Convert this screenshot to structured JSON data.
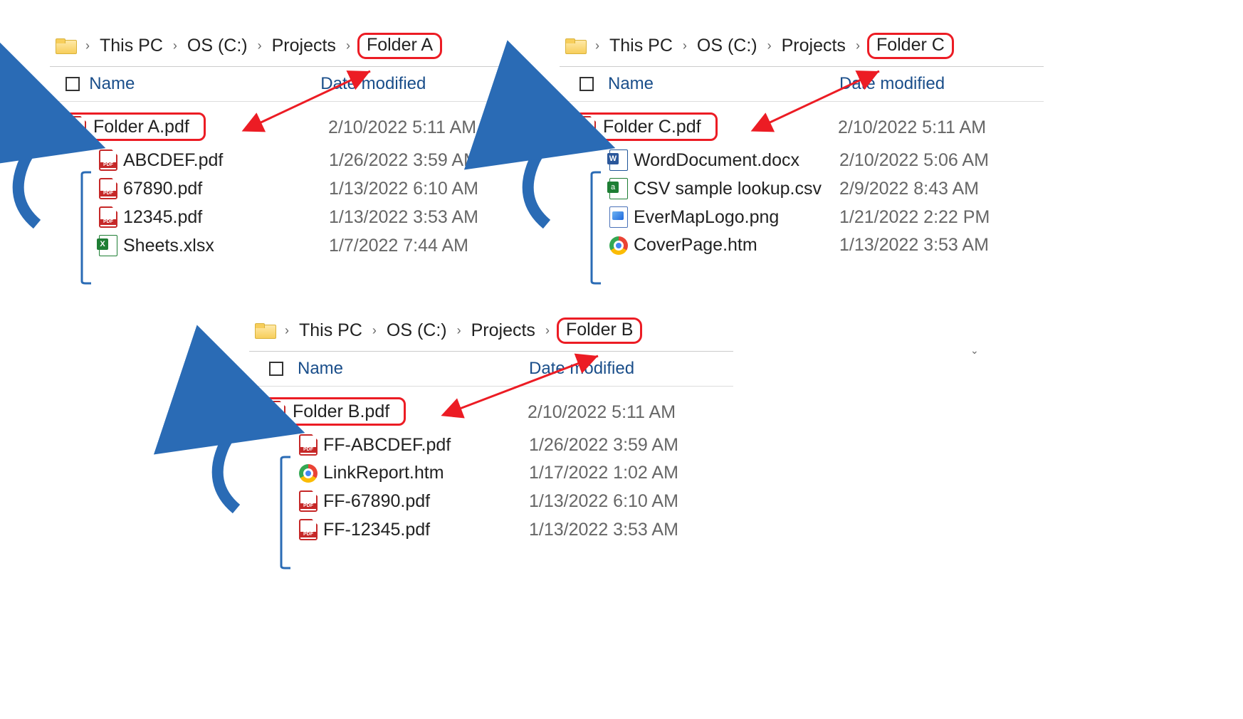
{
  "windows": [
    {
      "id": "a",
      "breadcrumb": [
        "This PC",
        "OS (C:)",
        "Projects",
        "Folder A"
      ],
      "headers": {
        "name": "Name",
        "date": "Date modified"
      },
      "files": [
        {
          "icon": "pdf",
          "name": "Folder A.pdf",
          "date": "2/10/2022 5:11 AM",
          "highlight": true
        },
        {
          "icon": "pdf",
          "name": "ABCDEF.pdf",
          "date": "1/26/2022 3:59 AM"
        },
        {
          "icon": "pdf",
          "name": "67890.pdf",
          "date": "1/13/2022 6:10 AM"
        },
        {
          "icon": "pdf",
          "name": "12345.pdf",
          "date": "1/13/2022 3:53 AM"
        },
        {
          "icon": "xlsx",
          "name": "Sheets.xlsx",
          "date": "1/7/2022 7:44 AM"
        }
      ]
    },
    {
      "id": "c",
      "breadcrumb": [
        "This PC",
        "OS (C:)",
        "Projects",
        "Folder C"
      ],
      "headers": {
        "name": "Name",
        "date": "Date modified"
      },
      "files": [
        {
          "icon": "pdf",
          "name": "Folder C.pdf",
          "date": "2/10/2022 5:11 AM",
          "highlight": true
        },
        {
          "icon": "docx",
          "name": "WordDocument.docx",
          "date": "2/10/2022 5:06 AM"
        },
        {
          "icon": "csv",
          "name": "CSV sample lookup.csv",
          "date": "2/9/2022 8:43 AM"
        },
        {
          "icon": "img",
          "name": "EverMapLogo.png",
          "date": "1/21/2022 2:22 PM"
        },
        {
          "icon": "htm",
          "name": "CoverPage.htm",
          "date": "1/13/2022 3:53 AM"
        }
      ]
    },
    {
      "id": "b",
      "breadcrumb": [
        "This PC",
        "OS (C:)",
        "Projects",
        "Folder B"
      ],
      "headers": {
        "name": "Name",
        "date": "Date modified"
      },
      "files": [
        {
          "icon": "pdf",
          "name": "Folder B.pdf",
          "date": "2/10/2022 5:11 AM",
          "highlight": true
        },
        {
          "icon": "pdf",
          "name": "FF-ABCDEF.pdf",
          "date": "1/26/2022 3:59 AM"
        },
        {
          "icon": "htm",
          "name": "LinkReport.htm",
          "date": "1/17/2022 1:02 AM"
        },
        {
          "icon": "pdf",
          "name": "FF-67890.pdf",
          "date": "1/13/2022 6:10 AM"
        },
        {
          "icon": "pdf",
          "name": "FF-12345.pdf",
          "date": "1/13/2022 3:53 AM"
        }
      ]
    }
  ],
  "colors": {
    "highlight": "#ec1c24",
    "blueArrow": "#2a6bb5"
  }
}
